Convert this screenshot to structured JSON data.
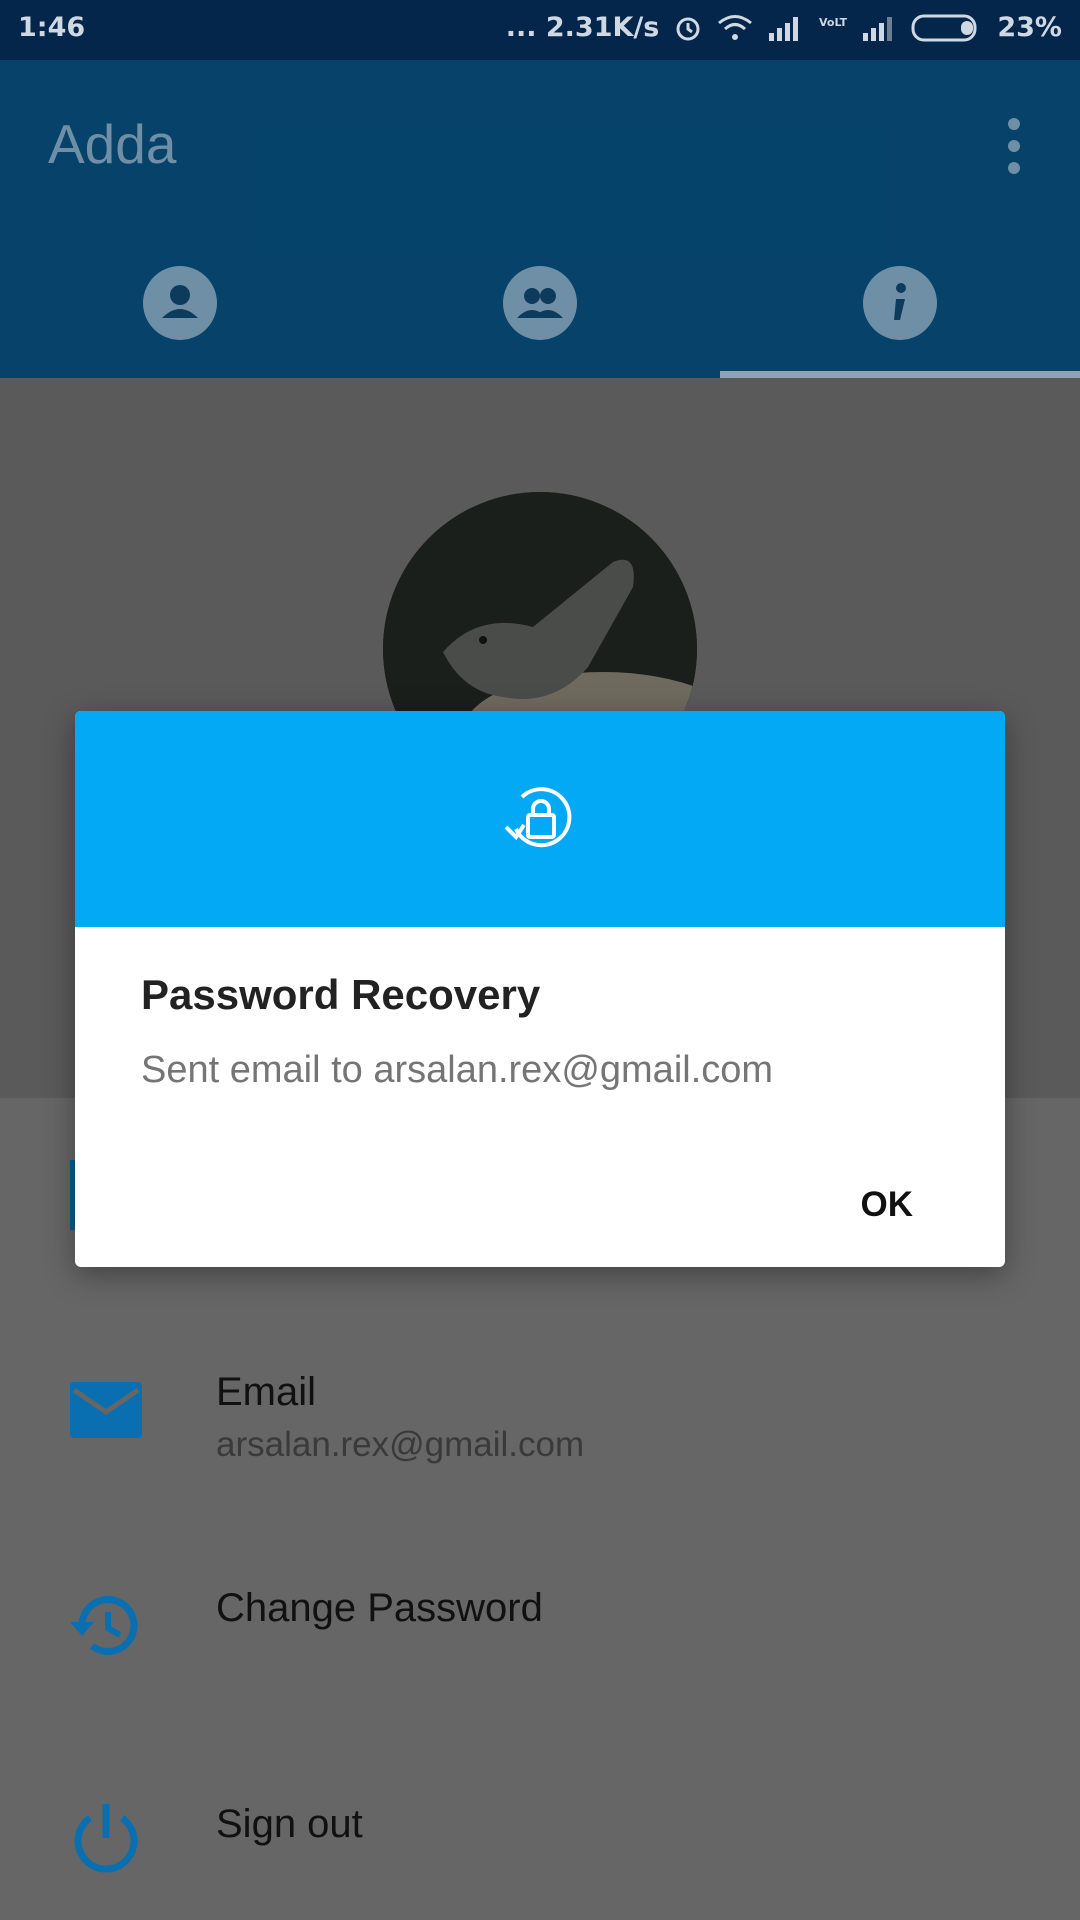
{
  "status_bar": {
    "time": "1:46",
    "net_speed": "... 2.31K/s",
    "battery": "23%",
    "icons": [
      "alarm-icon",
      "wifi-icon",
      "signal-icon",
      "volte-icon",
      "signal-icon",
      "battery-icon"
    ]
  },
  "app": {
    "title": "Adda",
    "tabs": [
      "profile-icon",
      "group-icon",
      "info-icon"
    ],
    "selected_tab": 2,
    "primary_color": "#0a6fb0"
  },
  "profile": {
    "rows": [
      {
        "icon": "email-icon",
        "label": "Email",
        "value": "arsalan.rex@gmail.com"
      },
      {
        "icon": "history-icon",
        "label": "Change Password"
      },
      {
        "icon": "power-icon",
        "label": "Sign out"
      }
    ]
  },
  "dialog": {
    "icon": "lock-reset-icon",
    "title": "Password Recovery",
    "message": "Sent email to arsalan.rex@gmail.com",
    "ok_label": "OK",
    "header_color": "#03a9f4"
  }
}
